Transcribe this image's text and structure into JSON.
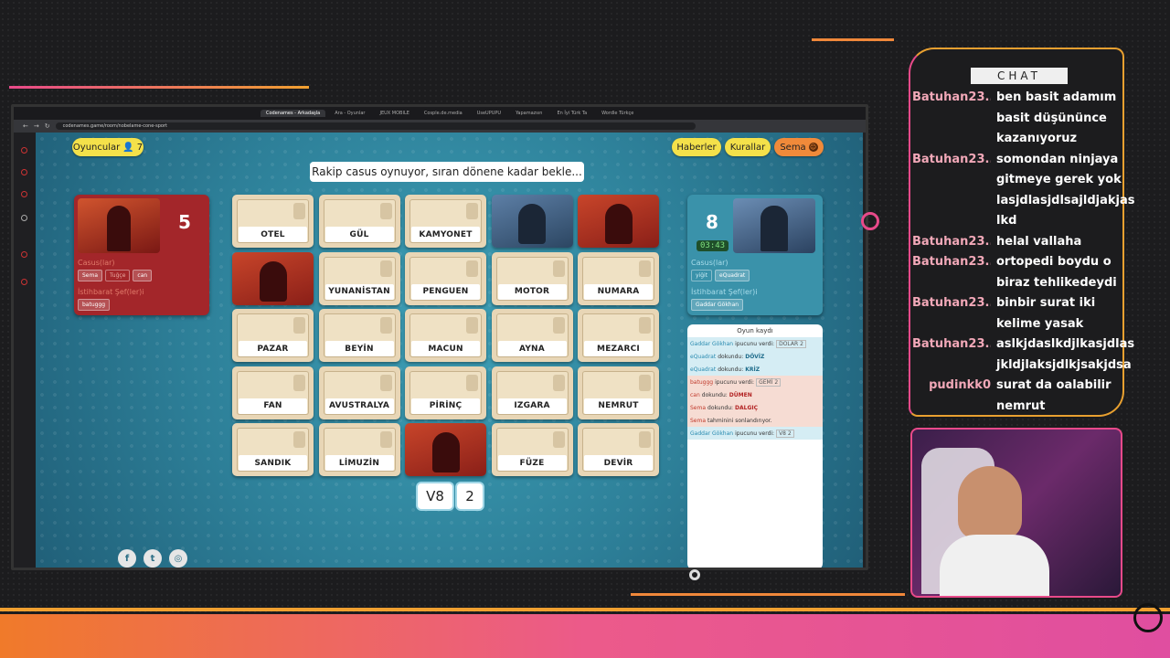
{
  "browser": {
    "tabs": [
      "Codenames - Arkadaşla",
      "Ara - Oyunlar",
      "JEUX MOBILE",
      "Cosple.de.media",
      "UseUPUPU",
      "Yapamazsın",
      "En İyi Türk Ta",
      "Wordle Türkçe"
    ],
    "url": "codenames.game/room/nobelame-cone-sport"
  },
  "game": {
    "players_label": "Oyuncular",
    "players_count": "7",
    "buttons": {
      "news": "Haberler",
      "rules": "Kurallar",
      "user": "Sema"
    },
    "banner": "Rakip casus oynuyor, sıran dönene kadar bekle...",
    "red_team": {
      "count": "5",
      "spies_label": "Casus(lar)",
      "spies": [
        "Sema",
        "Tuğçe",
        "can"
      ],
      "masters_label": "İstihbarat Şef(ler)i",
      "masters": [
        "batuggg"
      ]
    },
    "blue_team": {
      "count": "8",
      "timer": "03:43",
      "spies_label": "Casus(lar)",
      "spies": [
        "yiğit",
        "eQuadrat"
      ],
      "masters_label": "İstihbarat Şef(ler)i",
      "masters": [
        "Gaddar Gökhan"
      ]
    },
    "board": [
      {
        "word": "OTEL",
        "state": "hidden"
      },
      {
        "word": "GÜL",
        "state": "hidden"
      },
      {
        "word": "KAMYONET",
        "state": "hidden"
      },
      {
        "word": "",
        "state": "blue"
      },
      {
        "word": "",
        "state": "red"
      },
      {
        "word": "",
        "state": "red"
      },
      {
        "word": "YUNANİSTAN",
        "state": "hidden"
      },
      {
        "word": "PENGUEN",
        "state": "hidden"
      },
      {
        "word": "MOTOR",
        "state": "hidden"
      },
      {
        "word": "NUMARA",
        "state": "hidden"
      },
      {
        "word": "PAZAR",
        "state": "hidden"
      },
      {
        "word": "BEYİN",
        "state": "hidden"
      },
      {
        "word": "MACUN",
        "state": "hidden"
      },
      {
        "word": "AYNA",
        "state": "hidden"
      },
      {
        "word": "MEZARCI",
        "state": "hidden"
      },
      {
        "word": "FAN",
        "state": "hidden"
      },
      {
        "word": "AVUSTRALYA",
        "state": "hidden"
      },
      {
        "word": "PİRİNÇ",
        "state": "hidden"
      },
      {
        "word": "IZGARA",
        "state": "hidden"
      },
      {
        "word": "NEMRUT",
        "state": "hidden"
      },
      {
        "word": "SANDIK",
        "state": "hidden"
      },
      {
        "word": "LİMUZİN",
        "state": "hidden"
      },
      {
        "word": "",
        "state": "red"
      },
      {
        "word": "FÜZE",
        "state": "hidden"
      },
      {
        "word": "DEVİR",
        "state": "hidden"
      }
    ],
    "clue": {
      "word": "V8",
      "number": "2"
    },
    "log": {
      "title": "Oyun kaydı",
      "rows": [
        {
          "team": "blue",
          "who": "Gaddar Gökhan",
          "action": "ipucunu verdi:",
          "clue": "DOLAR 2",
          "target": ""
        },
        {
          "team": "blue",
          "who": "eQuadrat",
          "action": "dokundu:",
          "clue": "",
          "target": "DÖVİZ"
        },
        {
          "team": "blue",
          "who": "eQuadrat",
          "action": "dokundu:",
          "clue": "",
          "target": "KRİZ"
        },
        {
          "team": "red",
          "who": "batuggg",
          "action": "ipucunu verdi:",
          "clue": "GEMİ 2",
          "target": ""
        },
        {
          "team": "red",
          "who": "can",
          "action": "dokundu:",
          "clue": "",
          "target": "DÜMEN"
        },
        {
          "team": "red",
          "who": "Sema",
          "action": "dokundu:",
          "clue": "",
          "target": "DALGIÇ"
        },
        {
          "team": "red",
          "who": "Sema",
          "action": "tahminini sonlandırıyor.",
          "clue": "",
          "target": ""
        },
        {
          "team": "blue",
          "who": "Gaddar Gökhan",
          "action": "ipucunu verdi:",
          "clue": "V8 2",
          "target": ""
        }
      ]
    }
  },
  "chat": {
    "title": "CHAT",
    "messages": [
      {
        "user": "Batuhan23...",
        "lines": [
          "ben basit adamım",
          "basit düşününce",
          "kazanıyoruz"
        ]
      },
      {
        "user": "Batuhan23...",
        "lines": [
          "somondan ninjaya",
          "gitmeye gerek yok",
          "lasjdlasjdlsajldjakjas",
          "lkd"
        ]
      },
      {
        "user": "Batuhan23...",
        "lines": [
          "helal vallaha"
        ]
      },
      {
        "user": "Batuhan23...",
        "lines": [
          "ortopedi boydu o",
          "biraz tehlikedeydi"
        ]
      },
      {
        "user": "Batuhan23...",
        "lines": [
          "binbir surat iki",
          "kelime yasak"
        ]
      },
      {
        "user": "Batuhan23...",
        "lines": [
          "aslkjdaslkdjlkasjdlas",
          "jkldjlaksjdlkjsakjdsa"
        ]
      },
      {
        "user": "pudinkk0",
        "lines": [
          "surat da oalabilir",
          "nemrut"
        ]
      }
    ]
  },
  "colors": {
    "red_team": "#a3262a",
    "blue_team": "#3a92aa",
    "accent_pink": "#e84a8a",
    "accent_orange": "#e8a030"
  },
  "icons": {
    "players": "user-icon",
    "user_avatar": "smiley-icon",
    "socials": [
      "facebook-icon",
      "twitter-icon",
      "instagram-icon"
    ]
  }
}
